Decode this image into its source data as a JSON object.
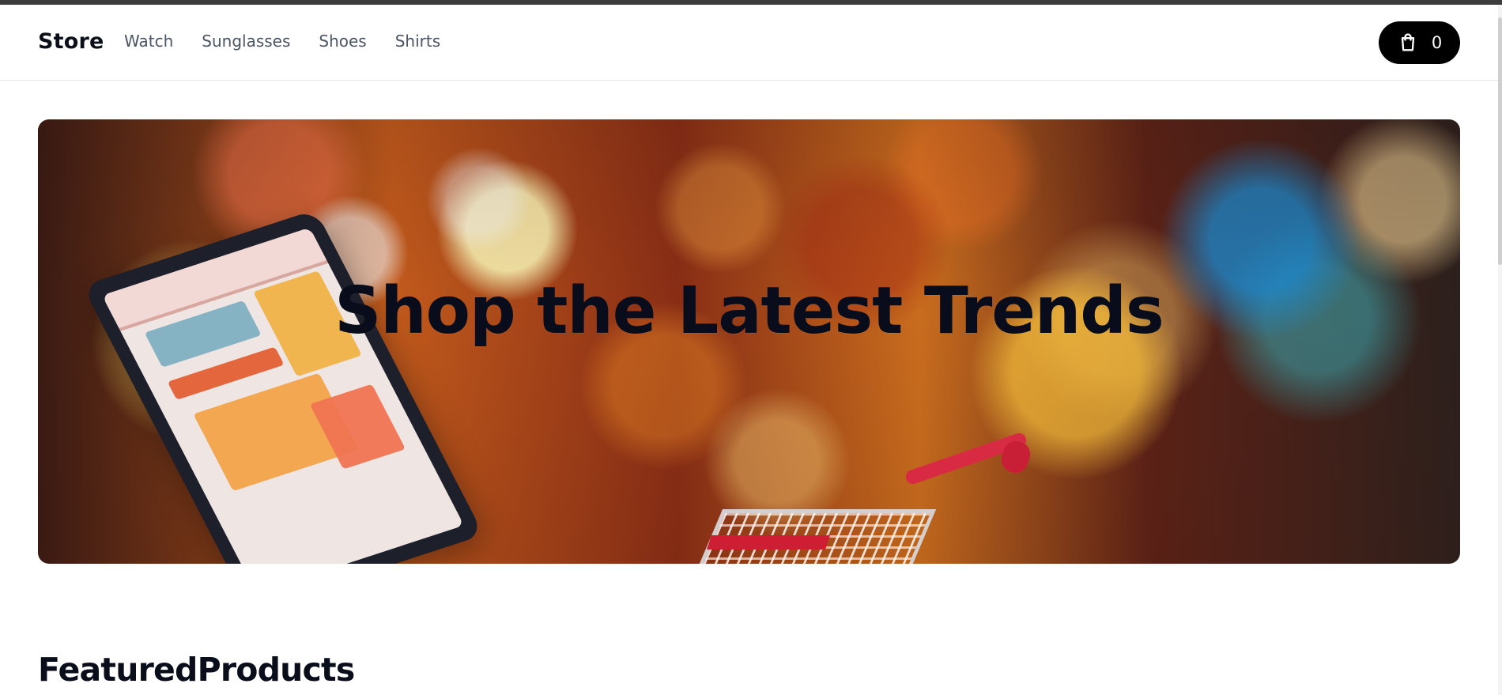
{
  "header": {
    "brand": "Store",
    "nav": [
      "Watch",
      "Sunglasses",
      "Shoes",
      "Shirts"
    ],
    "cart": {
      "count": "0",
      "icon": "shopping-bag-icon"
    }
  },
  "hero": {
    "title": "Shop the Latest Trends"
  },
  "featured": {
    "title": "FeaturedProducts"
  },
  "colors": {
    "header_text": "#0b0f19",
    "nav_text": "#4b5563",
    "cart_button": "#000000"
  }
}
